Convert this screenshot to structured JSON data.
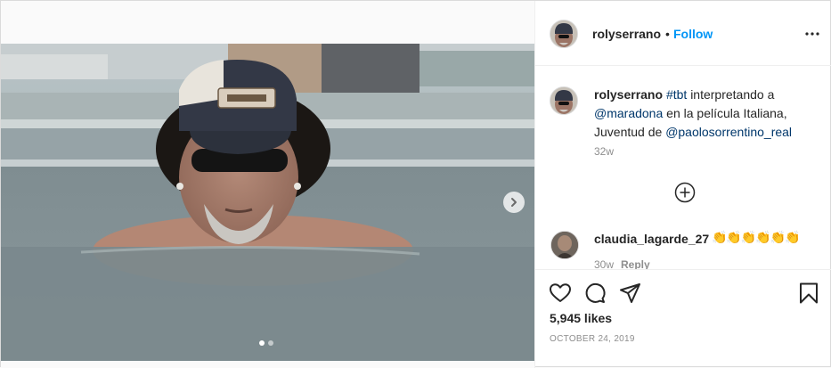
{
  "post": {
    "author": "rolyserrano",
    "separator": "•",
    "follow_label": "Follow",
    "caption": {
      "username": "rolyserrano",
      "hashtag": "#tbt",
      "text1": "interpretando a",
      "mention1": "@maradona",
      "text2": "en la película Italiana,",
      "text3": "Juventud de",
      "mention2": "@paolosorrentino_real"
    },
    "caption_time": "32w",
    "comments": [
      {
        "username": "claudia_lagarde_27",
        "text": "👏👏👏👏👏👏",
        "time": "30w",
        "reply_label": "Reply"
      }
    ],
    "likes": "5,945 likes",
    "date": "OCTOBER 24, 2019",
    "carousel": {
      "slides": 2,
      "current": 1
    }
  },
  "icons": {
    "more": "more-options-icon",
    "load_more": "plus-circle-icon",
    "like": "heart-icon",
    "comment": "comment-icon",
    "share": "share-icon",
    "save": "bookmark-icon",
    "next": "chevron-right-icon"
  },
  "colors": {
    "link": "#00376b",
    "follow": "#0095f6",
    "muted": "#8e8e8e",
    "text": "#262626"
  }
}
